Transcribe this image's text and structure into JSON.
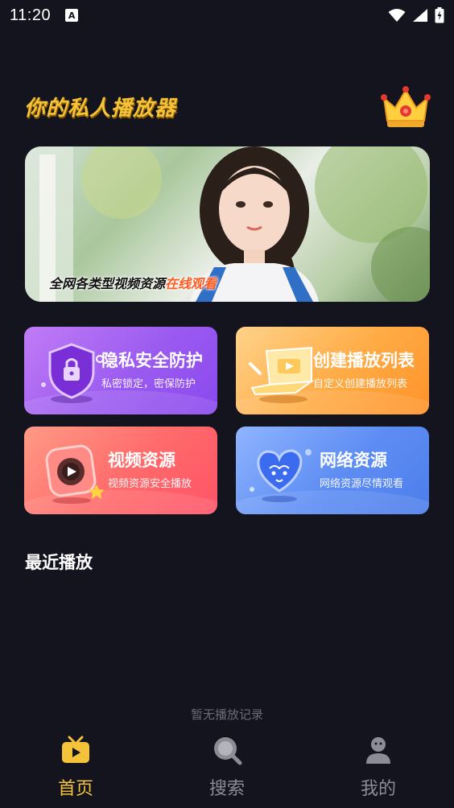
{
  "status_bar": {
    "time": "11:20",
    "notif_letter": "A"
  },
  "header": {
    "title": "你的私人播放器"
  },
  "banner": {
    "caption_main": "全网各类型视频资源",
    "caption_highlight": "在线观看"
  },
  "features": [
    {
      "title": "隐私安全防护",
      "subtitle": "私密锁定，密保防护"
    },
    {
      "title": "创建播放列表",
      "subtitle": "自定义创建播放列表"
    },
    {
      "title": "视频资源",
      "subtitle": "视频资源安全播放"
    },
    {
      "title": "网络资源",
      "subtitle": "网络资源尽情观看"
    }
  ],
  "recent": {
    "title": "最近播放",
    "empty_text": "暂无播放记录"
  },
  "nav": [
    {
      "label": "首页",
      "icon": "tv-icon",
      "active": true
    },
    {
      "label": "搜索",
      "icon": "search-icon",
      "active": false
    },
    {
      "label": "我的",
      "icon": "user-icon",
      "active": false
    }
  ],
  "colors": {
    "accent": "#f5c33a",
    "background": "#14141f",
    "nav_inactive": "#8c8c96"
  }
}
